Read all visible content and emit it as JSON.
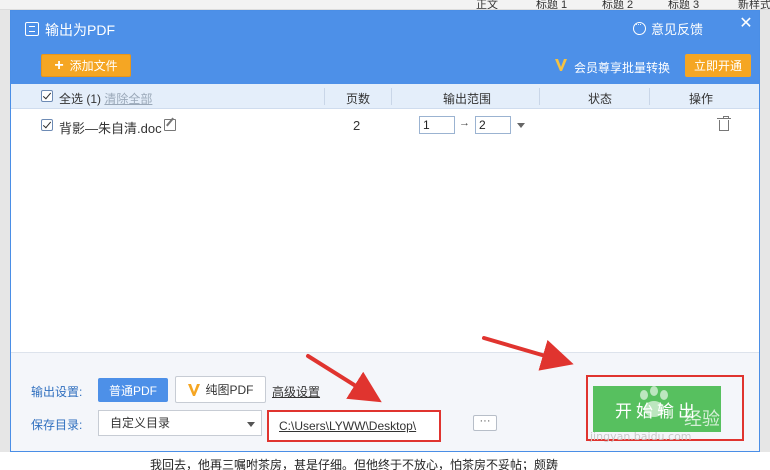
{
  "dialog": {
    "title": "输出为PDF",
    "feedback_label": "意见反馈",
    "close_label": "✕",
    "add_file_label": "添加文件",
    "member_text": "会员尊享批量转换",
    "open_label": "立即开通"
  },
  "table": {
    "select_all_label": "全选",
    "select_count": "(1)",
    "clear_all_label": "清除全部",
    "headers": {
      "pages": "页数",
      "range": "输出范围",
      "status": "状态",
      "action": "操作"
    },
    "rows": [
      {
        "file_name": "背影—朱自清.doc",
        "pages": "2",
        "range_from": "1",
        "range_to": "2",
        "status": ""
      }
    ]
  },
  "footer": {
    "output_setting_label": "输出设置:",
    "normal_pdf_label": "普通PDF",
    "image_pdf_label": "纯图PDF",
    "advanced_label": "高级设置",
    "save_dir_label": "保存目录:",
    "dir_mode": "自定义目录",
    "path": "C:\\Users\\LYWW\\Desktop\\",
    "browse_label": "···",
    "start_label": "开始输出"
  },
  "background": {
    "toolbar_items": [
      "正文",
      "标题 1",
      "标题 2",
      "标题 3",
      "新样式"
    ],
    "doc_line": "我回去，他再三嘱咐茶房，甚是仔细。但他终于不放心，怕茶房不妥帖；颇踌"
  },
  "watermark": {
    "text": "jingyan.baidu.com",
    "overlay": "经验"
  },
  "colors": {
    "title_bar": "#4d90e8",
    "accent_orange": "#f5a623",
    "start_green": "#57c05f",
    "highlight_red": "#e0342f"
  }
}
